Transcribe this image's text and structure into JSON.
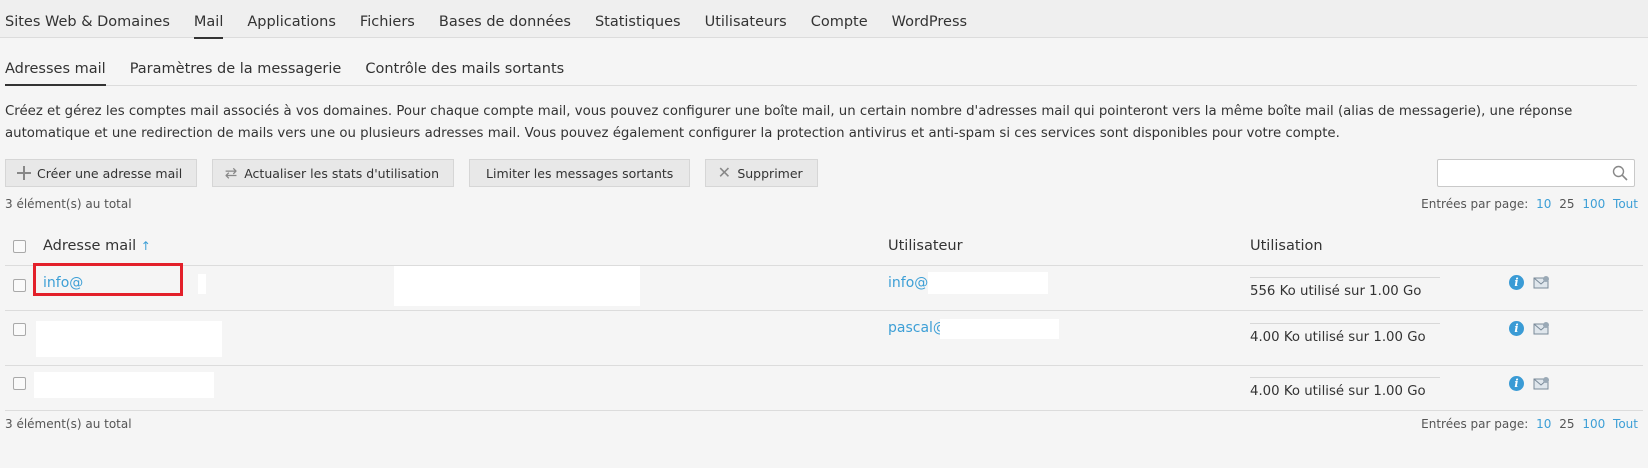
{
  "topnav": {
    "tabs": [
      {
        "label": "Sites Web & Domaines"
      },
      {
        "label": "Mail"
      },
      {
        "label": "Applications"
      },
      {
        "label": "Fichiers"
      },
      {
        "label": "Bases de données"
      },
      {
        "label": "Statistiques"
      },
      {
        "label": "Utilisateurs"
      },
      {
        "label": "Compte"
      },
      {
        "label": "WordPress"
      }
    ],
    "active": "Mail"
  },
  "subnav": {
    "tabs": [
      {
        "label": "Adresses mail"
      },
      {
        "label": "Paramètres de la messagerie"
      },
      {
        "label": "Contrôle des mails sortants"
      }
    ],
    "active": "Adresses mail"
  },
  "description": "Créez et gérez les comptes mail associés à vos domaines. Pour chaque compte mail, vous pouvez configurer une boîte mail, un certain nombre d'adresses mail qui pointeront vers la même boîte mail (alias de messagerie), une réponse automatique et une redirection de mails vers une ou plusieurs adresses mail. Vous pouvez également configurer la protection antivirus et anti-spam si ces services sont disponibles pour votre compte.",
  "toolbar": {
    "create_label": "Créer une adresse mail",
    "refresh_label": "Actualiser les stats d'utilisation",
    "limit_label": "Limiter les messages sortants",
    "delete_label": "Supprimer"
  },
  "search": {
    "placeholder": ""
  },
  "list": {
    "count_top": "3 élément(s) au total",
    "count_bottom": "3 élément(s) au total",
    "perpage_label": "Entrées par page:",
    "perpage_options": [
      "10",
      "25",
      "100",
      "Tout"
    ],
    "perpage_selected": "25"
  },
  "table": {
    "headers": {
      "email": "Adresse mail",
      "sort_indicator": "↑",
      "user": "Utilisateur",
      "usage": "Utilisation"
    },
    "rows": [
      {
        "email": "info@",
        "user": "info@",
        "usage": "556 Ko utilisé sur 1.00 Go"
      },
      {
        "email": "",
        "user": "pascal@",
        "usage": "4.00 Ko utilisé sur 1.00 Go"
      },
      {
        "email": "",
        "user": "",
        "usage": "4.00 Ko utilisé sur 1.00 Go"
      }
    ]
  },
  "colors": {
    "link": "#3d9fd6",
    "highlight": "#e3202a",
    "info_icon": "#3a9bd5"
  },
  "icons": {
    "create": "plus-icon",
    "refresh": "refresh-icon",
    "delete": "x-icon",
    "search": "search-icon",
    "info": "info-icon",
    "mail": "mail-icon"
  }
}
